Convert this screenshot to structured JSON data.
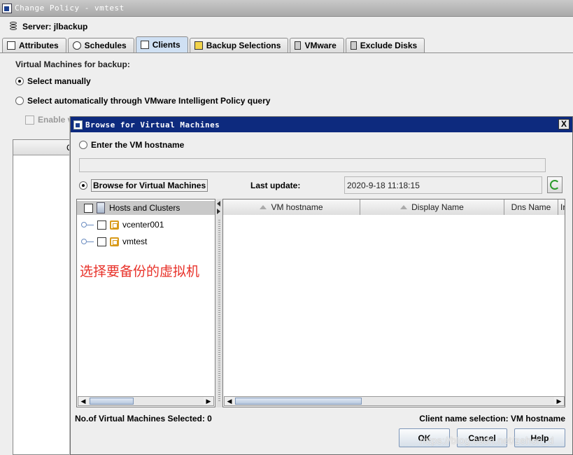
{
  "window": {
    "title": "Change Policy - vmtest"
  },
  "server": {
    "label": "Server: jlbackup"
  },
  "tabs": [
    {
      "label": "Attributes",
      "icon": "list-icon"
    },
    {
      "label": "Schedules",
      "icon": "clock-icon"
    },
    {
      "label": "Clients",
      "icon": "clients-icon",
      "active": true
    },
    {
      "label": "Backup Selections",
      "icon": "folder-icon"
    },
    {
      "label": "VMware",
      "icon": "server-icon"
    },
    {
      "label": "Exclude Disks",
      "icon": "disk-icon"
    }
  ],
  "policy": {
    "vm_label": "Virtual Machines for backup:",
    "select_manually": "Select manually",
    "select_auto": "Select automatically through VMware Intelligent Policy query",
    "enable_prefix": "Enable v",
    "panel_col": "C"
  },
  "dialog": {
    "title": "Browse for Virtual Machines",
    "close": "X",
    "enter_hostname": "Enter the VM hostname",
    "hostname_value": "",
    "browse_label": "Browse for Virtual Machines",
    "last_update_label": "Last update:",
    "last_update_value": "2020-9-18 11:18:15",
    "tree": {
      "root": "Hosts and Clusters",
      "items": [
        "vcenter001",
        "vmtest"
      ]
    },
    "annotation": "选择要备份的虚拟机",
    "columns": [
      "VM hostname",
      "Display Name",
      "Dns Name",
      "Ir"
    ],
    "status_left": "No.of Virtual Machines Selected: 0",
    "status_right": "Client name selection: VM hostname",
    "buttons": {
      "ok": "OK",
      "cancel": "Cancel",
      "help": "Help"
    }
  },
  "watermark": "https://blog.csdn.net/zehon_d"
}
